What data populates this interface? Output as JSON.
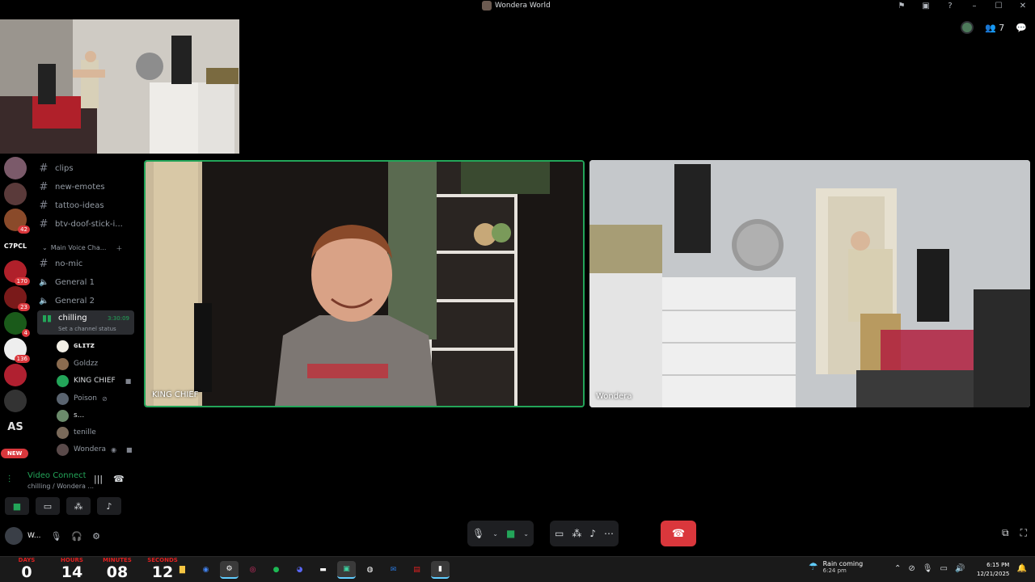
{
  "window": {
    "title": "Wondera World",
    "controls": [
      "flag-icon",
      "inbox-icon",
      "help-icon",
      "minimize-icon",
      "maximize-icon",
      "close-icon"
    ]
  },
  "topright": {
    "participant_count": "7"
  },
  "sidebar": {
    "channels": [
      {
        "type": "text",
        "name": "clips"
      },
      {
        "type": "text",
        "name": "new-emotes"
      },
      {
        "type": "text",
        "name": "tattoo-ideas"
      },
      {
        "type": "text",
        "name": "btv-doof-stick-i..."
      }
    ],
    "category": "Main Voice Cha...",
    "voice_channels": [
      {
        "type": "text",
        "name": "no-mic"
      },
      {
        "type": "voice",
        "name": "General 1"
      },
      {
        "type": "voice",
        "name": "General 2"
      }
    ],
    "active_channel": {
      "name": "chilling",
      "time": "3:30:09",
      "status": "Set a channel status"
    },
    "users": [
      {
        "name": "ɢʟɪᴛᴢ",
        "color": "#e6e6e6",
        "avatar": "#f2efe6"
      },
      {
        "name": "Goldzz",
        "color": "#949ba4",
        "avatar": "#8a6b4f"
      },
      {
        "name": "KING CHIEF",
        "color": "#dbdee1",
        "avatar": "#23a559"
      },
      {
        "name": "Poison",
        "color": "#949ba4",
        "avatar": "#5a6470"
      },
      {
        "name": "s...",
        "color": "#dbdee1",
        "avatar": "#6b8b6b"
      },
      {
        "name": "tenille",
        "color": "#949ba4",
        "avatar": "#7a6a5a"
      },
      {
        "name": "Wondera",
        "color": "#949ba4",
        "avatar": "#5a4a4a"
      }
    ],
    "server_badges": [
      "42",
      "170",
      "23",
      "4",
      "136"
    ],
    "server_labels": [
      "C7PCL",
      "AS"
    ],
    "new_label": "NEW"
  },
  "voice_panel": {
    "title": "Video Connected",
    "subtitle": "chilling / Wondera ...",
    "username": "W..."
  },
  "tiles": [
    {
      "label": "KING CHIEF",
      "speaking": true
    },
    {
      "label": "Wondera",
      "speaking": false
    }
  ],
  "taskbar": {
    "countdown": [
      {
        "label": "DAYS",
        "value": "0"
      },
      {
        "label": "HOURS",
        "value": "14"
      },
      {
        "label": "MINUTES",
        "value": "08"
      },
      {
        "label": "SECONDS",
        "value": "12"
      }
    ],
    "weather_title": "Rain coming",
    "weather_time": "6:24 pm",
    "time": "6:15 PM",
    "date": "12/21/2025"
  },
  "colors": {
    "accent_green": "#23a559",
    "hangup_red": "#da373c",
    "panel": "#1e1f22"
  }
}
